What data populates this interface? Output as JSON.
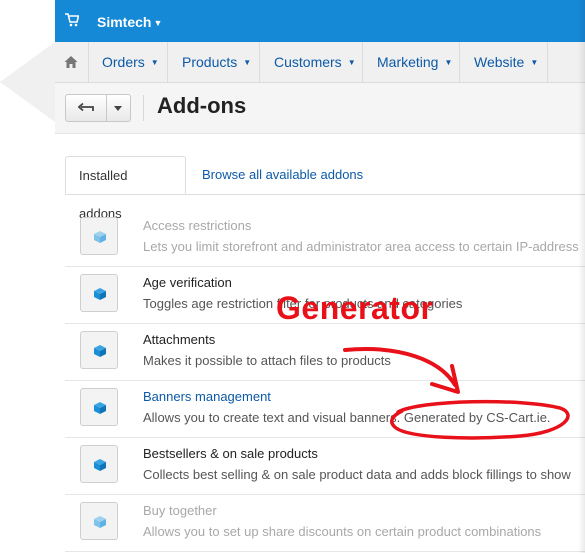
{
  "topbar": {
    "brand": "Simtech",
    "icon": "cart-icon"
  },
  "nav": {
    "home_icon": "home-icon",
    "items": [
      {
        "label": "Orders"
      },
      {
        "label": "Products"
      },
      {
        "label": "Customers"
      },
      {
        "label": "Marketing"
      },
      {
        "label": "Website"
      }
    ]
  },
  "toolbar": {
    "back_icon": "back-arrow-icon",
    "dropdown_icon": "chevron-down-icon",
    "title": "Add-ons"
  },
  "tabs": [
    {
      "label": "Installed addons",
      "active": true
    },
    {
      "label": "Browse all available addons",
      "active": false
    }
  ],
  "addons": [
    {
      "name": "Access restrictions",
      "desc": "Lets you limit storefront and administrator area access to certain IP-address",
      "disabled": true
    },
    {
      "name": "Age verification",
      "desc": "Toggles age restriction filter for products and categories",
      "disabled": false
    },
    {
      "name": "Attachments",
      "desc": "Makes it possible to attach files to products",
      "disabled": false
    },
    {
      "name": "Banners management",
      "desc": "Allows you to create text and visual banners. Generated by CS-Cart.ie.",
      "disabled": false,
      "link": true
    },
    {
      "name": "Bestsellers & on sale products",
      "desc": "Collects best selling & on sale product data and adds block fillings to show",
      "disabled": false
    },
    {
      "name": "Buy together",
      "desc": "Allows you to set up share discounts on certain product combinations",
      "disabled": true
    }
  ],
  "annotation": {
    "text": "Generator",
    "color": "#e8111a"
  },
  "colors": {
    "topbar": "#1588d6",
    "link": "#0d5aa7",
    "icon_blue": "#1a8fd6"
  }
}
